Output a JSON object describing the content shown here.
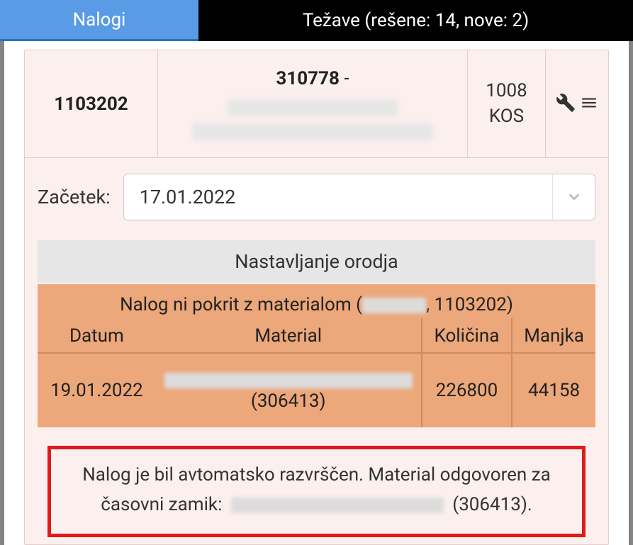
{
  "tabs": {
    "orders": "Nalogi",
    "issues": "Težave (rešene: 14, nove: 2)"
  },
  "order": {
    "id": "1103202",
    "product_code": "310778",
    "product_dash": " - ",
    "qty_value": "1008",
    "qty_unit": "KOS"
  },
  "start": {
    "label": "Začetek:",
    "value": "17.01.2022"
  },
  "tool_bar": "Nastavljanje orodja",
  "material": {
    "title_prefix": "Nalog ni pokrit z materialom (",
    "title_redacted": "",
    "title_mid": ", ",
    "title_order": "1103202",
    "title_suffix": ")",
    "headers": {
      "date": "Datum",
      "material": "Material",
      "qty": "Količina",
      "missing": "Manjka"
    },
    "rows": [
      {
        "date": "19.01.2022",
        "material_code": "(306413)",
        "qty": "226800",
        "missing": "44158"
      }
    ]
  },
  "alert": {
    "line1": "Nalog je bil avtomatsko razvrščen. Material odgovoren za",
    "line2_prefix": "časovni zamik: ",
    "line2_code": " (306413)."
  }
}
